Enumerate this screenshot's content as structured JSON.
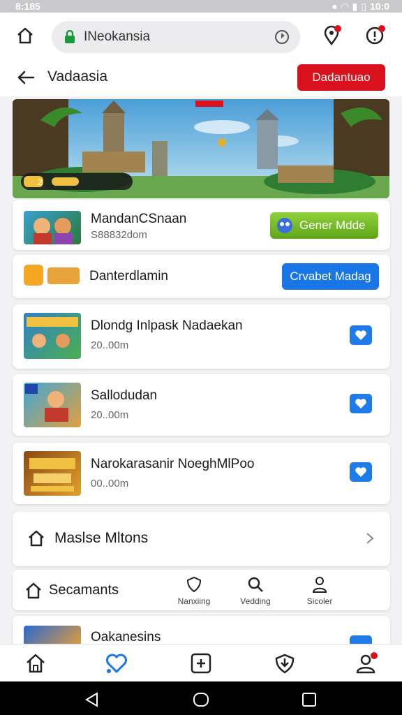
{
  "status_bar": {
    "time": "8:185",
    "right_text": "10:0"
  },
  "browser": {
    "url_text": "INeokansia"
  },
  "header": {
    "title": "Vadaasia",
    "action_label": "Dadantuao"
  },
  "hero": {
    "progress": 0.35,
    "badge_text": "2"
  },
  "featured": {
    "title": "MandanCSnaan",
    "subtitle": "S88832dom",
    "button_label": "Gener Mdde"
  },
  "promo": {
    "title": "Danterdlamin",
    "button_label": "Crvabet Madag"
  },
  "list_items": [
    {
      "title": "Dlondg Inlpask Nadaekan",
      "subtitle": "20..00m"
    },
    {
      "title": "Sallodudan",
      "subtitle": "20..00m"
    },
    {
      "title": "Narokarasanir NoeghMlPoo",
      "subtitle": "00..00m"
    }
  ],
  "more_row": {
    "label": "Maslse Mltons"
  },
  "tab_row": {
    "label": "Secamants",
    "tabs": [
      {
        "label": "Nanxiing"
      },
      {
        "label": "Vedding"
      },
      {
        "label": "Sicoler"
      }
    ]
  },
  "partial_item": {
    "title": "Oakanesins"
  },
  "colors": {
    "accent_red": "#d9111c",
    "accent_blue": "#1976e6",
    "accent_green": "#6bb421"
  }
}
